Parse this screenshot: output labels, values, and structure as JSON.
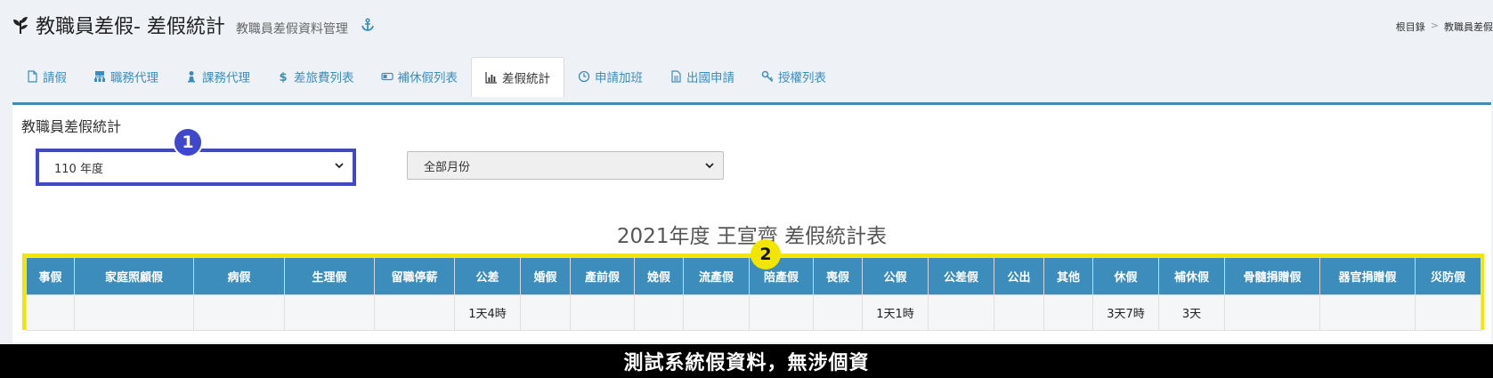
{
  "header": {
    "title": "教職員差假- 差假統計",
    "subtitle": "教職員差假資料管理",
    "breadcrumb": [
      "根目錄",
      "教職員差假"
    ],
    "breadcrumb_separator": ">"
  },
  "tabs": [
    {
      "label": "請假",
      "icon": "file-icon",
      "active": false
    },
    {
      "label": "職務代理",
      "icon": "sitemap-icon",
      "active": false
    },
    {
      "label": "課務代理",
      "icon": "user-icon",
      "active": false
    },
    {
      "label": "差旅費列表",
      "icon": "dollar-icon",
      "active": false
    },
    {
      "label": "補休假列表",
      "icon": "toggle-icon",
      "active": false
    },
    {
      "label": "差假統計",
      "icon": "bar-chart-icon",
      "active": true
    },
    {
      "label": "申請加班",
      "icon": "clock-icon",
      "active": false
    },
    {
      "label": "出國申請",
      "icon": "document-icon",
      "active": false
    },
    {
      "label": "授權列表",
      "icon": "key-icon",
      "active": false
    }
  ],
  "panel": {
    "title": "教職員差假統計",
    "year_select": {
      "value": "110 年度"
    },
    "month_select": {
      "value": "全部月份"
    },
    "annotations": {
      "badge1": "1",
      "badge2": "2"
    },
    "report_title": "2021年度 王宣齊 差假統計表"
  },
  "table": {
    "columns": [
      "事假",
      "家庭照顧假",
      "病假",
      "生理假",
      "留職停薪",
      "公差",
      "婚假",
      "產前假",
      "娩假",
      "流產假",
      "陪產假",
      "喪假",
      "公假",
      "公差假",
      "公出",
      "其他",
      "休假",
      "補休假",
      "骨髓捐贈假",
      "器官捐贈假",
      "災防假"
    ],
    "rows": [
      [
        "",
        "",
        "",
        "",
        "",
        "1天4時",
        "",
        "",
        "",
        "",
        "",
        "",
        "1天1時",
        "",
        "",
        "",
        "3天7時",
        "3天",
        "",
        "",
        ""
      ]
    ]
  },
  "footer": {
    "text": "測試系統假資料，無涉個資"
  },
  "colors": {
    "accent": "#3c8dbc",
    "annotation_blue": "#3f48cc",
    "annotation_yellow": "#f2e600"
  }
}
